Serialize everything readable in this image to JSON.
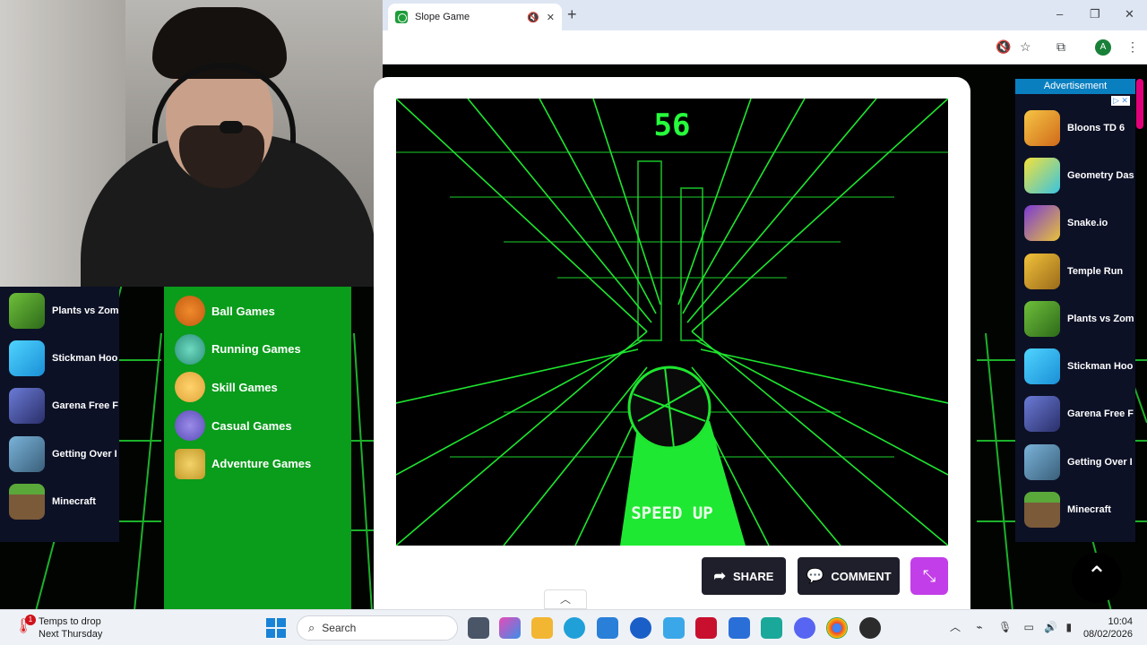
{
  "browser": {
    "tab_title": "Slope Game",
    "new_tab_symbol": "+",
    "close_symbol": "✕",
    "mute_symbol": "🔇",
    "profile_initial": "A",
    "window_controls": [
      "–",
      "❐",
      "✕"
    ]
  },
  "game": {
    "score": "56",
    "message": "SPEED UP",
    "accent_color": "#26ff3c"
  },
  "actions": {
    "share_label": "SHARE",
    "comment_label": "COMMENT"
  },
  "categories": [
    {
      "label": "Ball Games",
      "icon": "basketball-icon"
    },
    {
      "label": "Running Games",
      "icon": "runner-icon"
    },
    {
      "label": "Skill Games",
      "icon": "hands-icon"
    },
    {
      "label": "Casual Games",
      "icon": "gamepad-icon"
    },
    {
      "label": "Adventure Games",
      "icon": "treasure-icon"
    }
  ],
  "left_games": [
    {
      "label": "Plants vs Zom",
      "icon": "plants-vs-zombies-icon"
    },
    {
      "label": "Stickman Hoo",
      "icon": "stickman-hook-icon"
    },
    {
      "label": "Garena Free F",
      "icon": "free-fire-icon"
    },
    {
      "label": "Getting Over I",
      "icon": "getting-over-it-icon"
    },
    {
      "label": "Minecraft",
      "icon": "minecraft-icon"
    }
  ],
  "advertisement": {
    "label": "Advertisement",
    "choices_badge": "▷ ✕"
  },
  "right_games": [
    {
      "label": "Bloons TD 6",
      "icon": "bloons-icon"
    },
    {
      "label": "Geometry Das",
      "icon": "geometry-dash-icon"
    },
    {
      "label": "Snake.io",
      "icon": "snake-icon"
    },
    {
      "label": "Temple Run",
      "icon": "temple-run-icon"
    },
    {
      "label": "Plants vs Zom",
      "icon": "plants-vs-zombies-icon"
    },
    {
      "label": "Stickman Hoo",
      "icon": "stickman-hook-icon"
    },
    {
      "label": "Garena Free F",
      "icon": "free-fire-icon"
    },
    {
      "label": "Getting Over I",
      "icon": "getting-over-it-icon"
    },
    {
      "label": "Minecraft",
      "icon": "minecraft-icon"
    }
  ],
  "taskbar": {
    "weather_line1": "Temps to drop",
    "weather_line2": "Next Thursday",
    "weather_badge": "1",
    "search_placeholder": "Search",
    "time": "10:04",
    "date": "08/02/2026"
  },
  "colors": {
    "category_green": "#0a9c1b",
    "side_panel_bg": "#0d1126",
    "fullscreen_purple": "#c23ee8",
    "ad_blue": "#0a7fc0"
  }
}
